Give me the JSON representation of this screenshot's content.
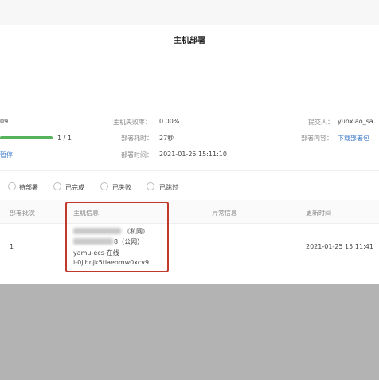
{
  "dialog": {
    "title": "主机部署"
  },
  "summary": {
    "id_fragment": "09",
    "progress_fraction": 1.0,
    "progress_text": "1 / 1",
    "status_fragment": "暂停",
    "host_failure_rate_label": "主机失败率：",
    "host_failure_rate_value": "0.00%",
    "duration_label": "部署耗时：",
    "duration_value": "27秒",
    "deploy_time_label": "部署时间：",
    "deploy_time_value": "2021-01-25 15:11:10",
    "submitter_label": "提交人：",
    "submitter_value": "yunxiao_sa",
    "content_label": "部署内容：",
    "content_link": "下载部署包"
  },
  "filters": [
    {
      "label": "待部署"
    },
    {
      "label": "已完成"
    },
    {
      "label": "已失败"
    },
    {
      "label": "已跳过"
    }
  ],
  "table": {
    "headers": [
      "部署批次",
      "主机信息",
      "异常信息",
      "更新时间"
    ],
    "rows": [
      {
        "batch": "1",
        "host_private_suffix": "（私网）",
        "host_public_suffix": "8（公网）",
        "host_name": "yamu-ecs-在线",
        "host_instance": "i-0jlhnjk5tlaeomw0xcv9",
        "error": "",
        "updated": "2021-01-25 15:11:41"
      }
    ]
  },
  "colors": {
    "progress": "#56b35c",
    "link": "#3a78c9",
    "highlight": "#c0392b"
  }
}
